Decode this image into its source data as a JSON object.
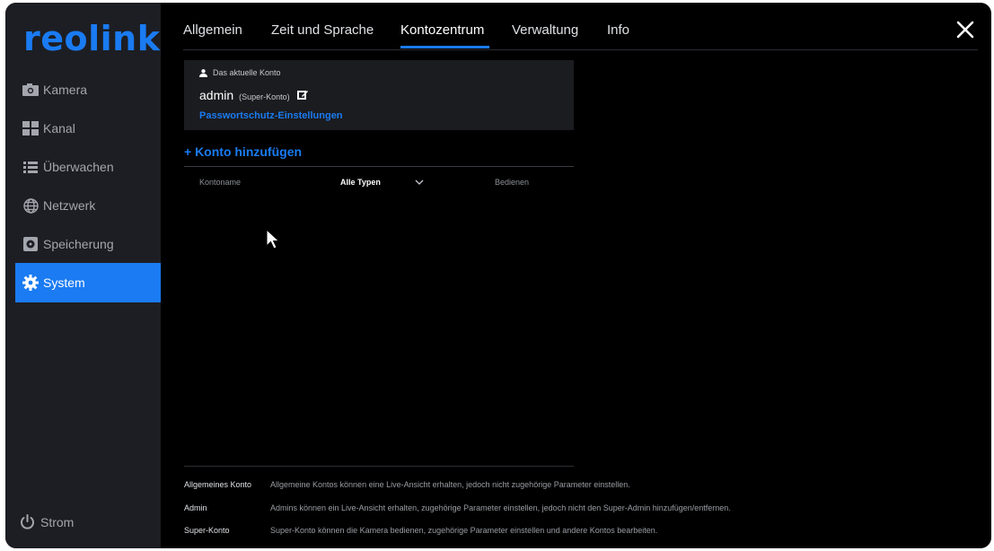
{
  "brand": {
    "logo_text": "reolink",
    "accent_color": "#1a7bf2"
  },
  "sidebar": {
    "items": [
      {
        "label": "Kamera",
        "icon": "camera-icon",
        "active": false
      },
      {
        "label": "Kanal",
        "icon": "channel-grid-icon",
        "active": false
      },
      {
        "label": "Überwachen",
        "icon": "list-icon",
        "active": false
      },
      {
        "label": "Netzwerk",
        "icon": "globe-icon",
        "active": false
      },
      {
        "label": "Speicherung",
        "icon": "storage-icon",
        "active": false
      },
      {
        "label": "System",
        "icon": "gear-icon",
        "active": true
      }
    ],
    "power_label": "Strom"
  },
  "tabs": [
    {
      "label": "Allgemein",
      "active": false
    },
    {
      "label": "Zeit und Sprache",
      "active": false
    },
    {
      "label": "Kontozentrum",
      "active": true
    },
    {
      "label": "Verwaltung",
      "active": false
    },
    {
      "label": "Info",
      "active": false
    }
  ],
  "account": {
    "heading": "Das aktuelle Konto",
    "name": "admin",
    "role": "(Super-Konto)",
    "password_link": "Passwortschutz-Einstellungen"
  },
  "add_account_label": "+ Konto hinzufügen",
  "table": {
    "col_name": "Kontoname",
    "col_type": "Alle Typen",
    "col_action": "Bedienen"
  },
  "legend": [
    {
      "term": "Allgemeines Konto",
      "desc": "Allgemeine Kontos können eine Live-Ansicht erhalten, jedoch nicht zugehörige Parameter einstellen."
    },
    {
      "term": "Admin",
      "desc": "Admins können ein Live-Ansicht erhalten, zugehörige Parameter einstellen, jedoch nicht den Super-Admin hinzufügen/entfernen."
    },
    {
      "term": "Super-Konto",
      "desc": "Super-Konto können die Kamera bedienen, zugehörige Parameter einstellen und andere Kontos bearbeiten."
    }
  ]
}
